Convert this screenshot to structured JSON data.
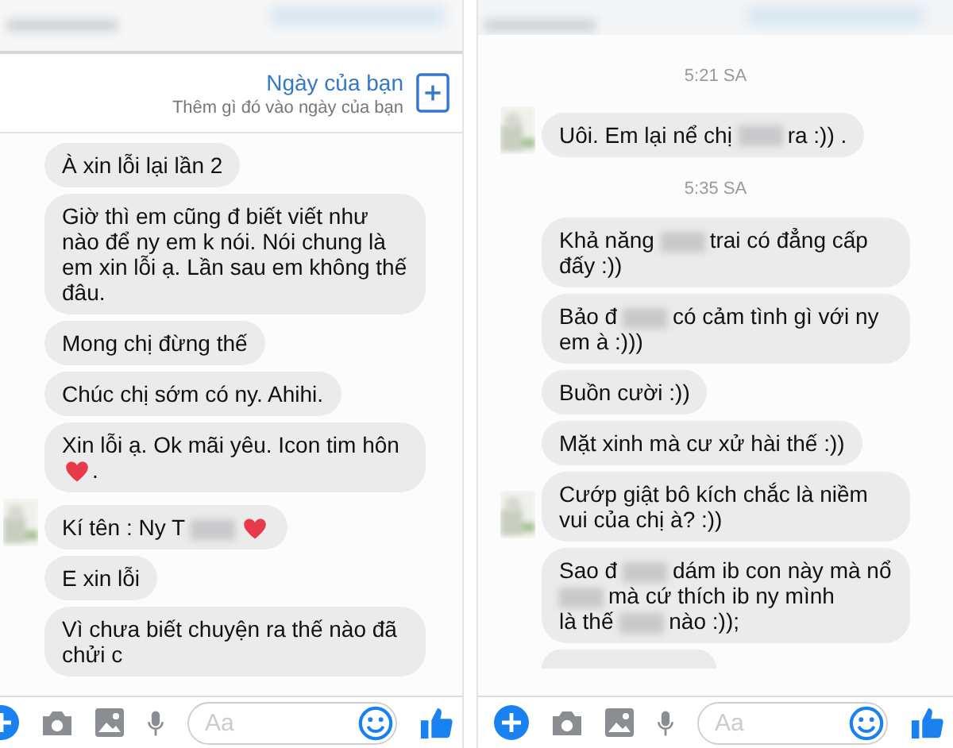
{
  "panels": [
    {
      "day_card": {
        "title": "Ngày của bạn",
        "subtitle": "Thêm gì đó vào ngày của bạn"
      },
      "items": [
        {
          "kind": "message",
          "avatar": false,
          "segments": [
            {
              "kind": "text",
              "text": "À xin lỗi lại lần 2"
            }
          ]
        },
        {
          "kind": "message",
          "avatar": false,
          "segments": [
            {
              "kind": "text",
              "text": "Giờ thì em cũng đ biết viết như nào để ny em k nói.  Nói chung là em xin lỗi ạ.  Lần sau em không thế đâu."
            }
          ]
        },
        {
          "kind": "message",
          "avatar": false,
          "segments": [
            {
              "kind": "text",
              "text": "Mong chị đừng thế"
            }
          ]
        },
        {
          "kind": "message",
          "avatar": false,
          "segments": [
            {
              "kind": "text",
              "text": "Chúc chị sớm có ny. Ahihi."
            }
          ]
        },
        {
          "kind": "message",
          "avatar": false,
          "segments": [
            {
              "kind": "text",
              "text": "Xin lỗi ạ.  Ok mãi yêu.  Icon tim hôn"
            },
            {
              "kind": "heart"
            },
            {
              "kind": "text",
              "text": "."
            }
          ]
        },
        {
          "kind": "message",
          "avatar": true,
          "segments": [
            {
              "kind": "text",
              "text": "Kí tên : Ny T"
            },
            {
              "kind": "blur"
            },
            {
              "kind": "heart"
            }
          ]
        },
        {
          "kind": "message",
          "avatar": false,
          "segments": [
            {
              "kind": "text",
              "text": "E xin lỗi"
            }
          ]
        },
        {
          "kind": "message",
          "avatar": false,
          "segments": [
            {
              "kind": "text",
              "text": "Vì chưa biết chuyện ra thế nào đã chửi c"
            }
          ]
        }
      ],
      "composer": {
        "placeholder": "Aa"
      }
    },
    {
      "items": [
        {
          "kind": "time",
          "text": "5:21 SA"
        },
        {
          "kind": "message",
          "avatar": true,
          "segments": [
            {
              "kind": "text",
              "text": "Uôi.  Em lại nể chị"
            },
            {
              "kind": "blur"
            },
            {
              "kind": "text",
              "text": "ra :)) ."
            }
          ]
        },
        {
          "kind": "time",
          "text": "5:35 SA"
        },
        {
          "kind": "message",
          "avatar": false,
          "segments": [
            {
              "kind": "text",
              "text": "Khả năng"
            },
            {
              "kind": "blur"
            },
            {
              "kind": "text",
              "text": "trai có đẳng cấp"
            },
            {
              "kind": "text",
              "text": "đấy :))"
            }
          ]
        },
        {
          "kind": "message",
          "avatar": false,
          "segments": [
            {
              "kind": "text",
              "text": "Bảo đ"
            },
            {
              "kind": "blur"
            },
            {
              "kind": "text",
              "text": "có cảm tình gì với ny"
            },
            {
              "kind": "text",
              "text": "em à :)))"
            }
          ]
        },
        {
          "kind": "message",
          "avatar": false,
          "segments": [
            {
              "kind": "text",
              "text": "Buồn cười :))"
            }
          ]
        },
        {
          "kind": "message",
          "avatar": false,
          "segments": [
            {
              "kind": "text",
              "text": "Mặt xinh mà cư xử hài thế :))"
            }
          ]
        },
        {
          "kind": "message",
          "avatar": true,
          "segments": [
            {
              "kind": "text",
              "text": "Cướp giật bô kích chắc là niềm vui của chị à? :))"
            }
          ]
        },
        {
          "kind": "message",
          "avatar": false,
          "segments": [
            {
              "kind": "text",
              "text": "Sao đ"
            },
            {
              "kind": "blur"
            },
            {
              "kind": "text",
              "text": "dám ib con này mà nổ"
            },
            {
              "kind": "blur"
            },
            {
              "kind": "text",
              "text": "mà cứ thích ib ny mình"
            },
            {
              "kind": "text",
              "text": "là thế"
            },
            {
              "kind": "blur"
            },
            {
              "kind": "text",
              "text": "nào :));"
            }
          ]
        },
        {
          "kind": "cut_bubble"
        }
      ],
      "composer": {
        "placeholder": "Aa"
      }
    }
  ]
}
